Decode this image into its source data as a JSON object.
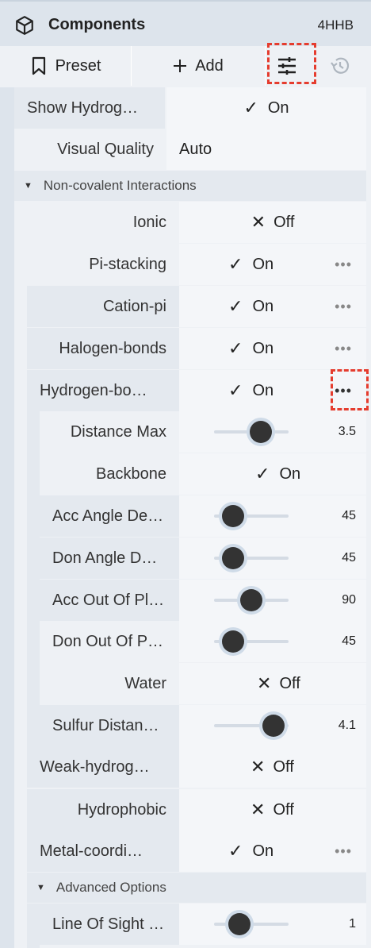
{
  "header": {
    "title": "Components",
    "pdb_id": "4HHB",
    "icon": "cube-icon"
  },
  "toolbar": {
    "preset_label": "Preset",
    "add_label": "Add",
    "tune_icon": "sliders-icon",
    "history_icon": "history-icon"
  },
  "settings": {
    "show_hydrogens": {
      "label": "Show Hydrog…",
      "value": "On"
    },
    "visual_quality": {
      "label": "Visual Quality",
      "value": "Auto"
    }
  },
  "noncovalent": {
    "title": "Non-covalent Interactions",
    "ionic": {
      "label": "Ionic",
      "value": "Off"
    },
    "pi_stacking": {
      "label": "Pi-stacking",
      "value": "On"
    },
    "cation_pi": {
      "label": "Cation-pi",
      "value": "On"
    },
    "halogen_bonds": {
      "label": "Halogen-bonds",
      "value": "On"
    },
    "hydrogen_bonds": {
      "label": "Hydrogen-bo…",
      "value": "On"
    },
    "hbond_params": {
      "distance_max": {
        "label": "Distance Max",
        "value": "3.5",
        "fraction": 0.63
      },
      "backbone": {
        "label": "Backbone",
        "value": "On"
      },
      "acc_angle": {
        "label": "Acc Angle De…",
        "value": "45",
        "fraction": 0.25
      },
      "don_angle": {
        "label": "Don Angle D…",
        "value": "45",
        "fraction": 0.25
      },
      "acc_out_of_plane": {
        "label": "Acc Out Of Pl…",
        "value": "90",
        "fraction": 0.5
      },
      "don_out_of_plane": {
        "label": "Don Out Of P…",
        "value": "45",
        "fraction": 0.25
      },
      "water": {
        "label": "Water",
        "value": "Off"
      },
      "sulfur_distance": {
        "label": "Sulfur Distan…",
        "value": "4.1",
        "fraction": 0.8
      }
    },
    "weak_hydrogen": {
      "label": "Weak-hydrog…",
      "value": "Off"
    },
    "hydrophobic": {
      "label": "Hydrophobic",
      "value": "Off"
    },
    "metal_coordination": {
      "label": "Metal-coordi…",
      "value": "On"
    },
    "advanced": {
      "title": "Advanced Options",
      "line_of_sight": {
        "label": "Line Of Sight …",
        "value": "1",
        "fraction": 0.34
      }
    }
  },
  "colors": {
    "highlight": "#e53c2e",
    "knob": "#333333",
    "panel": "#eef1f5",
    "header": "#dde4ec"
  }
}
